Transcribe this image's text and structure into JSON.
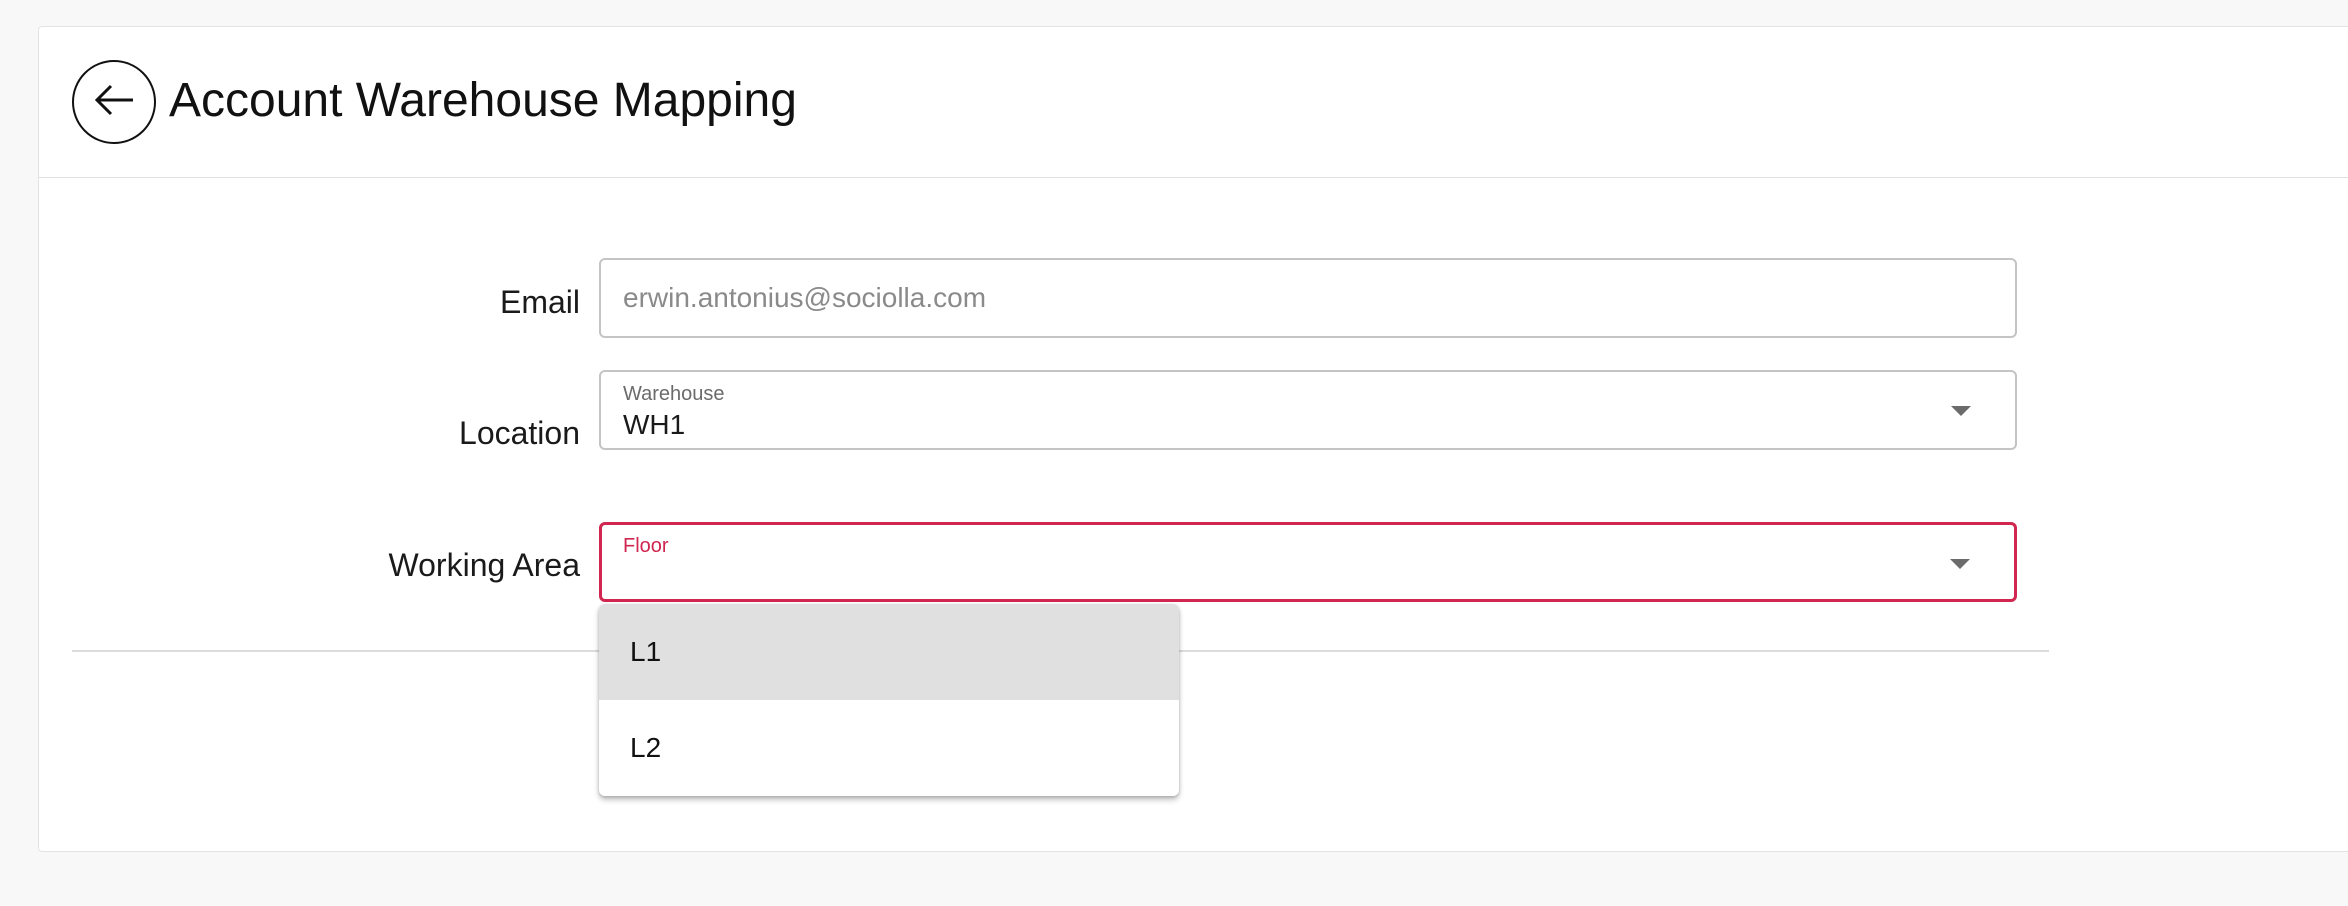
{
  "header": {
    "title": "Account Warehouse Mapping"
  },
  "form": {
    "email": {
      "label": "Email",
      "value": "erwin.antonius@sociolla.com"
    },
    "location": {
      "label": "Location",
      "field_label": "Warehouse",
      "selected": "WH1"
    },
    "working_area": {
      "label": "Working Area",
      "field_label": "Floor",
      "selected": ""
    }
  },
  "dropdown": {
    "options": [
      {
        "label": "L1",
        "highlighted": true
      },
      {
        "label": "L2",
        "highlighted": false
      }
    ]
  },
  "icons": {
    "back": "arrow-left-icon",
    "caret": "caret-down-icon"
  },
  "colors": {
    "focus_accent": "#d0264f",
    "highlight": "#e0e0e0"
  }
}
